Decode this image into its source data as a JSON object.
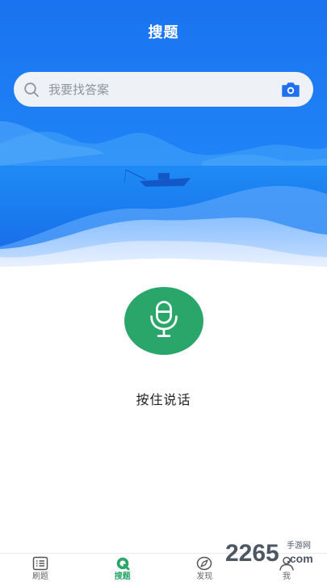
{
  "header": {
    "title": "搜题"
  },
  "search": {
    "placeholder": "我要找答案"
  },
  "voice": {
    "label": "按住说话"
  },
  "tabbar": {
    "items": [
      {
        "label": "刷题",
        "icon": "list-icon",
        "active": false
      },
      {
        "label": "搜题",
        "icon": "search-q-icon",
        "active": true
      },
      {
        "label": "发现",
        "icon": "compass-icon",
        "active": false
      },
      {
        "label": "我",
        "icon": "user-icon",
        "active": false
      }
    ]
  },
  "watermark": {
    "text": "2265",
    "sub": "手游网",
    "domain": ".com"
  },
  "colors": {
    "primary_blue": "#1f6ff0",
    "accent_green": "#2aa66a",
    "search_bg": "#eef1f5",
    "camera_blue": "#1f6ff0"
  }
}
